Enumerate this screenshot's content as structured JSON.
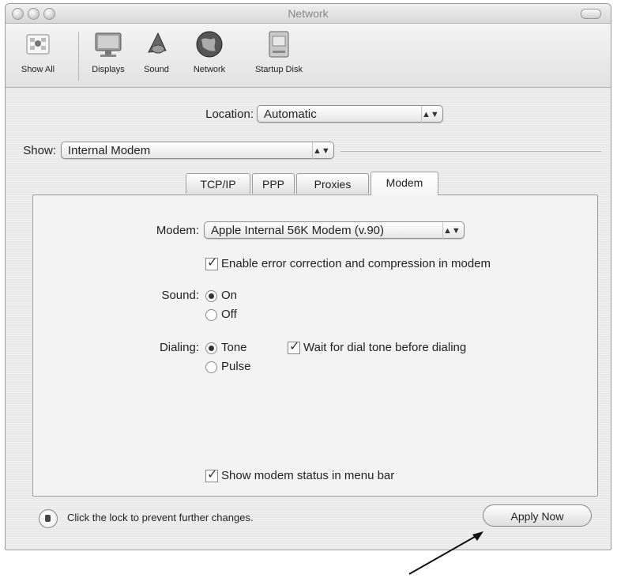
{
  "window": {
    "title": "Network"
  },
  "toolbar": {
    "items": [
      {
        "label": "Show All",
        "icon": "apple-grid-icon"
      },
      {
        "label": "Displays",
        "icon": "display-icon"
      },
      {
        "label": "Sound",
        "icon": "speaker-icon"
      },
      {
        "label": "Network",
        "icon": "globe-icon"
      },
      {
        "label": "Startup Disk",
        "icon": "disk-icon"
      }
    ]
  },
  "location": {
    "label": "Location:",
    "value": "Automatic"
  },
  "show": {
    "label": "Show:",
    "value": "Internal Modem"
  },
  "tabs": [
    {
      "label": "TCP/IP"
    },
    {
      "label": "PPP"
    },
    {
      "label": "Proxies"
    },
    {
      "label": "Modem",
      "selected": true
    }
  ],
  "modem": {
    "label": "Modem:",
    "value": "Apple Internal 56K Modem (v.90)",
    "error_correction": {
      "label": "Enable error correction and compression in modem",
      "checked": true
    },
    "sound": {
      "label": "Sound:",
      "options": [
        "On",
        "Off"
      ],
      "selected": "On"
    },
    "dialing": {
      "label": "Dialing:",
      "options": [
        "Tone",
        "Pulse"
      ],
      "selected": "Tone"
    },
    "wait_dial_tone": {
      "label": "Wait for dial tone before dialing",
      "checked": true
    },
    "menu_bar_status": {
      "label": "Show modem status in menu bar",
      "checked": true
    }
  },
  "footer": {
    "lock_text": "Click the lock to prevent further changes.",
    "apply_label": "Apply Now"
  }
}
